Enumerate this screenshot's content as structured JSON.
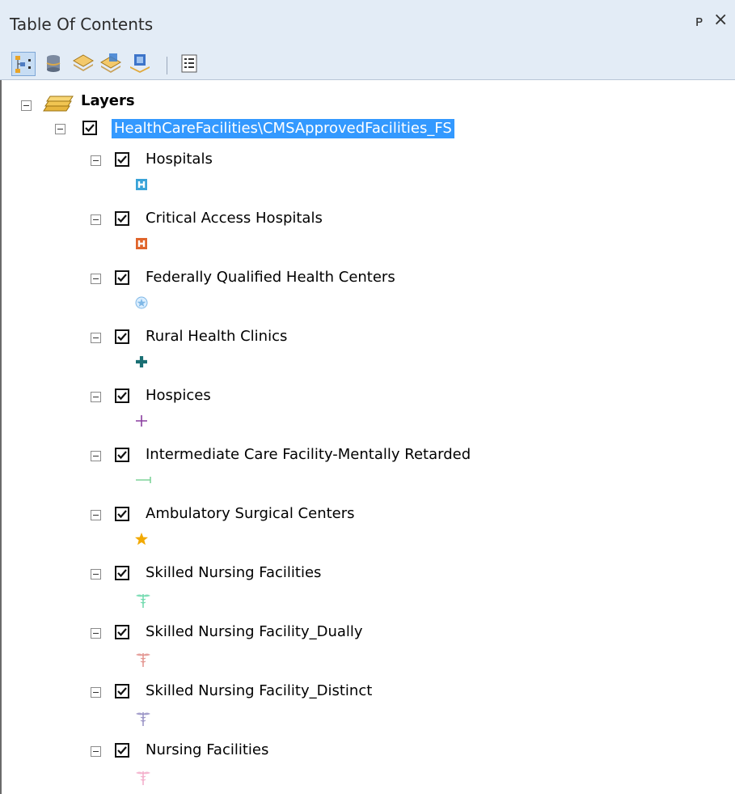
{
  "window": {
    "title": "Table Of Contents",
    "pin_glyph": "ᴘ",
    "close_glyph": "×"
  },
  "toolbar": {
    "buttons": [
      {
        "name": "list-by-drawing-order-icon",
        "active": true
      },
      {
        "name": "list-by-source-icon",
        "active": false
      },
      {
        "name": "list-by-visibility-icon",
        "active": false
      },
      {
        "name": "list-by-selection-icon",
        "active": false
      },
      {
        "name": "options-icon",
        "active": false
      }
    ]
  },
  "tree": {
    "root_label": "Layers",
    "service_label": "HealthCareFacilities\\CMSApprovedFacilities_FS",
    "layers": [
      {
        "label": "Hospitals",
        "symbol": "hospital-h-blue-icon",
        "color": "#3aa3d8"
      },
      {
        "label": "Critical Access Hospitals",
        "symbol": "hospital-h-orange-icon",
        "color": "#e0652c"
      },
      {
        "label": "Federally Qualified Health Centers",
        "symbol": "star-circle-icon",
        "color": "#7fb8e6"
      },
      {
        "label": "Rural Health Clinics",
        "symbol": "cross-teal-icon",
        "color": "#1a6f73"
      },
      {
        "label": "Hospices",
        "symbol": "cross-purple-icon",
        "color": "#8a3fa0"
      },
      {
        "label": "Intermediate Care Facility-Mentally Retarded",
        "symbol": "line-tick-icon",
        "color": "#7fd49a"
      },
      {
        "label": "Ambulatory Surgical Centers",
        "symbol": "star-icon",
        "color": "#f2a900"
      },
      {
        "label": "Skilled Nursing Facilities",
        "symbol": "caduceus-icon",
        "color": "#62d6a6"
      },
      {
        "label": "Skilled Nursing Facility_Dually",
        "symbol": "caduceus-icon",
        "color": "#e08a84"
      },
      {
        "label": "Skilled Nursing Facility_Distinct",
        "symbol": "caduceus-icon",
        "color": "#8f88bf"
      },
      {
        "label": "Nursing Facilities",
        "symbol": "caduceus-icon",
        "color": "#f2a6c6"
      }
    ]
  }
}
